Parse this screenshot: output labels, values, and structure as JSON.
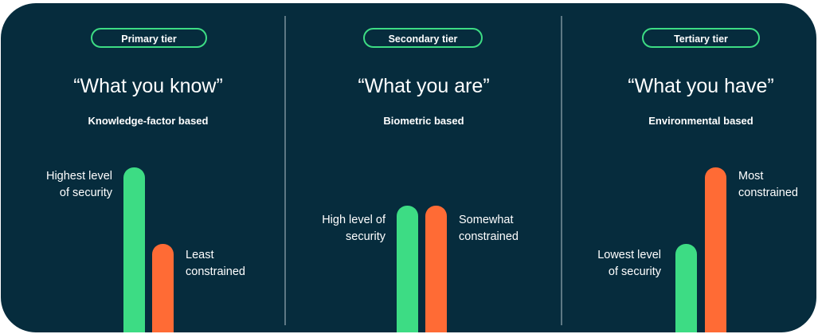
{
  "colors": {
    "background": "#062c3d",
    "security_bar": "#3ddc84",
    "constraint_bar": "#ff6b35",
    "pill_border": "#3ddc84",
    "divider": "#5d7884"
  },
  "tiers": [
    {
      "pill": "Primary tier",
      "quote": "“What you know”",
      "subtitle": "Knowledge-factor based",
      "security": {
        "label_line1": "Highest level",
        "label_line2": "of security",
        "level": 1.0
      },
      "constraint": {
        "label_line1": "Least",
        "label_line2": "constrained",
        "level": 0.5
      }
    },
    {
      "pill": "Secondary tier",
      "quote": "“What you are”",
      "subtitle": "Biometric based",
      "security": {
        "label_line1": "High level of",
        "label_line2": "security",
        "level": 0.75
      },
      "constraint": {
        "label_line1": "Somewhat",
        "label_line2": "constrained",
        "level": 0.75
      }
    },
    {
      "pill": "Tertiary tier",
      "quote": "“What you have”",
      "subtitle": "Environmental based",
      "security": {
        "label_line1": "Lowest level",
        "label_line2": "of security",
        "level": 0.5
      },
      "constraint": {
        "label_line1": "Most",
        "label_line2": "constrained",
        "level": 1.0
      }
    }
  ]
}
